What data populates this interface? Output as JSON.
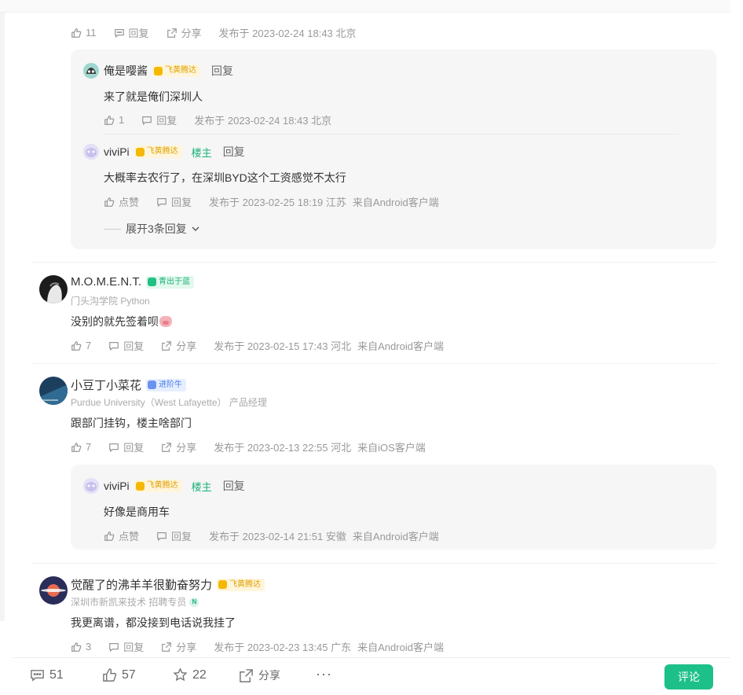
{
  "top_actions": {
    "likes": "11",
    "reply": "回复",
    "share": "分享",
    "meta": "发布于 2023-02-24 18:43 北京"
  },
  "thread1": {
    "reply1": {
      "user": "俺是嘤酱",
      "badge": "飞黄腾达",
      "reply_link": "回复",
      "text": "来了就是俺们深圳人",
      "likes": "1",
      "reply": "回复",
      "meta": "发布于 2023-02-24 18:43 北京"
    },
    "reply2": {
      "user": "viviPi",
      "badge": "飞黄腾达",
      "owner": "楼主",
      "reply_link": "回复",
      "text": "大概率去农行了，在深圳BYD这个工资感觉不太行",
      "likes": "点赞",
      "reply": "回复",
      "meta": "发布于 2023-02-25 18:19 江苏",
      "source": "来自Android客户端"
    },
    "expand": "展开3条回复"
  },
  "comment2": {
    "user": "M.O.M.E.N.T.",
    "badge": "青出于蓝",
    "sub": "门头沟学院 Python",
    "text": "没别的就先签着呗",
    "likes": "7",
    "reply": "回复",
    "share": "分享",
    "meta": "发布于 2023-02-15 17:43 河北",
    "source": "来自Android客户端"
  },
  "comment3": {
    "user": "小豆丁小菜花",
    "badge": "进阶牛",
    "sub": "Purdue University（West Lafayette） 产品经理",
    "text": "跟部门挂钩，楼主啥部门",
    "likes": "7",
    "reply": "回复",
    "share": "分享",
    "meta": "发布于 2023-02-13 22:55 河北",
    "source": "来自iOS客户端",
    "reply1": {
      "user": "viviPi",
      "badge": "飞黄腾达",
      "owner": "楼主",
      "reply_link": "回复",
      "text": "好像是商用车",
      "likes": "点赞",
      "reply": "回复",
      "meta": "发布于 2023-02-14 21:51 安徽",
      "source": "来自Android客户端"
    }
  },
  "comment4": {
    "user": "觉醒了的沸羊羊很勤奋努力",
    "badge": "飞黄腾达",
    "sub": "深圳市新凯来技术  招聘专员",
    "sub_badge": "N",
    "text": "我更离谱，都没接到电话说我挂了",
    "likes": "3",
    "reply": "回复",
    "share": "分享",
    "meta": "发布于 2023-02-23 13:45 广东",
    "source": "来自Android客户端"
  },
  "bottom_bar": {
    "comments": "51",
    "likes": "57",
    "stars": "22",
    "share": "分享",
    "more": "···",
    "comment_button": "评论"
  },
  "colors": {
    "accent": "#1ec08a",
    "gold_badge": "#f5b800",
    "reply_bg": "#f6f6f6"
  }
}
